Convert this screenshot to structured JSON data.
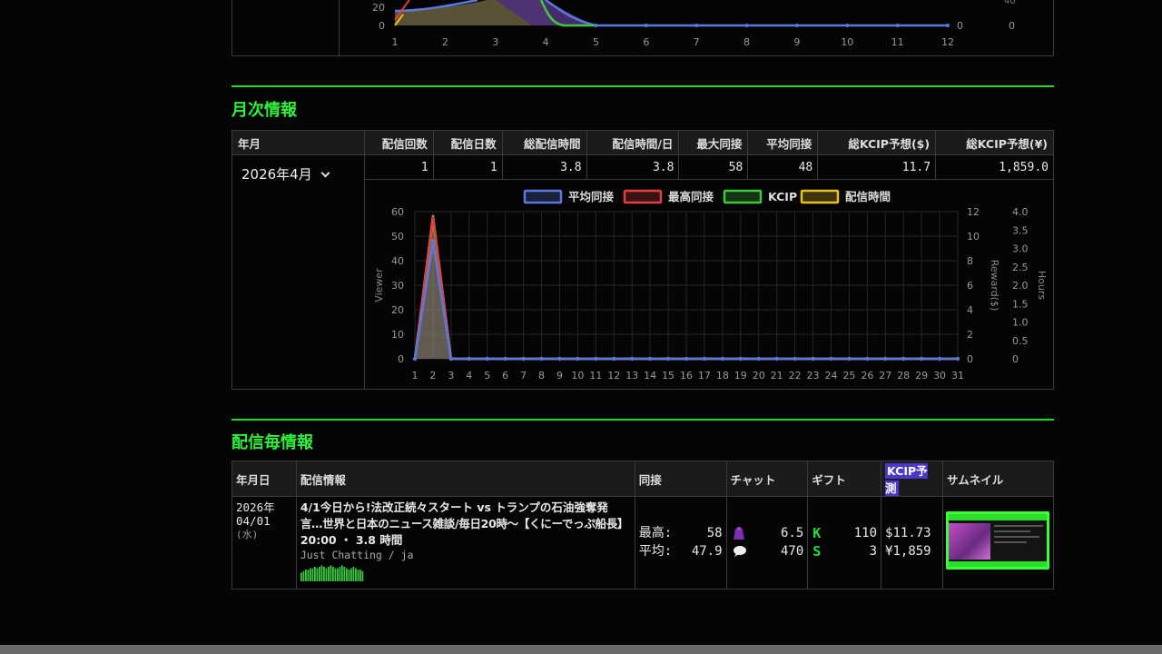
{
  "top_chart": {
    "y_ticks": [
      "20",
      "0"
    ],
    "x_ticks": [
      "1",
      "2",
      "3",
      "4",
      "5",
      "6",
      "7",
      "8",
      "9",
      "10",
      "11",
      "12"
    ],
    "right_ticks": [
      "0"
    ],
    "right2_ticks": [
      "0"
    ]
  },
  "monthly": {
    "title": "月次情報",
    "headers": [
      "年月",
      "配信回数",
      "配信日数",
      "総配信時間",
      "配信時間/日",
      "最大同接",
      "平均同接",
      "総KCIP予想($)",
      "総KCIP予想(¥)"
    ],
    "selected_month": "2026年4月",
    "values": [
      "1",
      "1",
      "3.8",
      "3.8",
      "58",
      "48",
      "11.7",
      "1,859.0"
    ],
    "colors": {
      "avg": "#5b78e0",
      "max": "#e04040",
      "kcip": "#3ec83e",
      "hours": "#e8c020"
    }
  },
  "chart_data": {
    "type": "line",
    "x": [
      1,
      2,
      3,
      4,
      5,
      6,
      7,
      8,
      9,
      10,
      11,
      12,
      13,
      14,
      15,
      16,
      17,
      18,
      19,
      20,
      21,
      22,
      23,
      24,
      25,
      26,
      27,
      28,
      29,
      30,
      31
    ],
    "series": [
      {
        "name": "平均同接",
        "axis": "Viewer",
        "values": [
          0,
          48,
          0,
          0,
          0,
          0,
          0,
          0,
          0,
          0,
          0,
          0,
          0,
          0,
          0,
          0,
          0,
          0,
          0,
          0,
          0,
          0,
          0,
          0,
          0,
          0,
          0,
          0,
          0,
          0,
          0
        ]
      },
      {
        "name": "最高同接",
        "axis": "Viewer",
        "values": [
          0,
          58,
          0,
          0,
          0,
          0,
          0,
          0,
          0,
          0,
          0,
          0,
          0,
          0,
          0,
          0,
          0,
          0,
          0,
          0,
          0,
          0,
          0,
          0,
          0,
          0,
          0,
          0,
          0,
          0,
          0
        ]
      },
      {
        "name": "KCIP",
        "axis": "Reward($)",
        "values": [
          0,
          11.7,
          0,
          0,
          0,
          0,
          0,
          0,
          0,
          0,
          0,
          0,
          0,
          0,
          0,
          0,
          0,
          0,
          0,
          0,
          0,
          0,
          0,
          0,
          0,
          0,
          0,
          0,
          0,
          0,
          0
        ]
      },
      {
        "name": "配信時間",
        "axis": "Hours",
        "values": [
          0,
          3.8,
          0,
          0,
          0,
          0,
          0,
          0,
          0,
          0,
          0,
          0,
          0,
          0,
          0,
          0,
          0,
          0,
          0,
          0,
          0,
          0,
          0,
          0,
          0,
          0,
          0,
          0,
          0,
          0,
          0
        ]
      }
    ],
    "y_left": {
      "label": "Viewer",
      "ticks": [
        "60",
        "50",
        "40",
        "30",
        "20",
        "10",
        "0"
      ],
      "range": [
        0,
        60
      ]
    },
    "y_right": {
      "label": "Reward($)",
      "ticks": [
        "12",
        "10",
        "8",
        "6",
        "4",
        "2",
        "0"
      ],
      "range": [
        0,
        12
      ]
    },
    "y_right2": {
      "label": "Hours",
      "ticks": [
        "4.0",
        "3.5",
        "3.0",
        "2.5",
        "2.0",
        "1.5",
        "1.0",
        "0.5",
        "0"
      ],
      "range": [
        0,
        4
      ]
    },
    "legend_position": "top",
    "grid": true
  },
  "stream": {
    "title": "配信毎情報",
    "headers": [
      "年月日",
      "配信情報",
      "同接",
      "チャット",
      "ギフト",
      "KCIP予測",
      "サムネイル"
    ],
    "row": {
      "date_year": "2026年",
      "date_md": "04/01",
      "date_dow": "(水)",
      "title_line1": "4/1今日から!法改正続々スタート vs トランプの石油強奪発",
      "title_line2": "言…世界と日本のニュース雑談/毎日20時〜【くにーでっぷ船長】",
      "time": "20:00 ・ 3.8 時間",
      "category": "Just Chatting / ja",
      "max_label": "最高:",
      "max_value": "58",
      "avg_label": "平均:",
      "avg_value": "47.9",
      "chat_rate": "6.5",
      "chat_count": "470",
      "kick_gift": "110",
      "sub_gift": "3",
      "kcip_usd": "$11.73",
      "kcip_jpy": "¥1,859",
      "gift_k_icon": "kick-k",
      "gift_s_icon": "sub-s",
      "chat_icon_a": "purple-bag-icon",
      "chat_icon_b": "speech-bubble-icon",
      "activity_bars": [
        6,
        7,
        8,
        8,
        9,
        9,
        10,
        9,
        10,
        11,
        10,
        9,
        10,
        11,
        10,
        9,
        9,
        10,
        11,
        10,
        9,
        8,
        9,
        10,
        9,
        8,
        8,
        7
      ]
    }
  }
}
